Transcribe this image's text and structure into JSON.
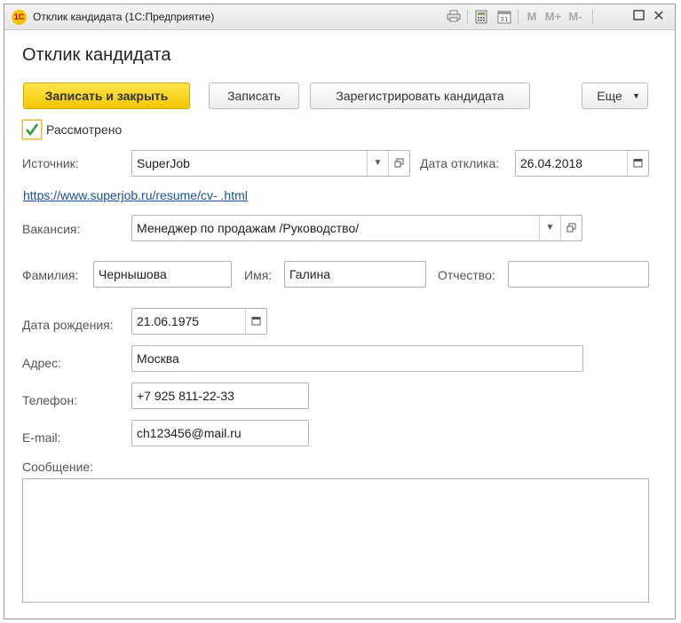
{
  "window": {
    "title": "Отклик кандидата  (1С:Предприятие)",
    "app_logo": "1С",
    "toolbar": {
      "mem_m": "M",
      "mem_mplus": "M+",
      "mem_mminus": "M-",
      "close": "✕"
    }
  },
  "form": {
    "title": "Отклик кандидата",
    "buttons": {
      "save_close": "Записать и закрыть",
      "save": "Записать",
      "register": "Зарегистрировать кандидата",
      "more": "Еще"
    },
    "reviewed": {
      "label": "Рассмотрено",
      "checked": true
    },
    "source": {
      "label": "Источник:",
      "value": "SuperJob"
    },
    "response_date": {
      "label": "Дата отклика:",
      "value": "26.04.2018"
    },
    "resume_link": "https://www.superjob.ru/resume/cv-          .html",
    "vacancy": {
      "label": "Вакансия:",
      "value": "Менеджер по продажам /Руководство/"
    },
    "last_name": {
      "label": "Фамилия:",
      "value": "Чернышова"
    },
    "first_name": {
      "label": "Имя:",
      "value": "Галина"
    },
    "middle_name": {
      "label": "Отчество:",
      "value": ""
    },
    "birth_date": {
      "label": "Дата рождения:",
      "value": "21.06.1975"
    },
    "address": {
      "label": "Адрес:",
      "value": "Москва"
    },
    "phone": {
      "label": "Телефон:",
      "value": "+7 925 811-22-33"
    },
    "email": {
      "label": "E-mail:",
      "value": "ch123456@mail.ru"
    },
    "message": {
      "label": "Сообщение:",
      "value": ""
    }
  },
  "colors": {
    "accent": "#f4c600",
    "link": "#1a4fa0",
    "check": "#2e9a3e"
  },
  "icons": [
    "printer-icon",
    "calculator-icon",
    "calendar-icon",
    "maximize-icon",
    "close-icon",
    "dropdown-arrow-icon",
    "open-icon",
    "checkmark-icon"
  ]
}
